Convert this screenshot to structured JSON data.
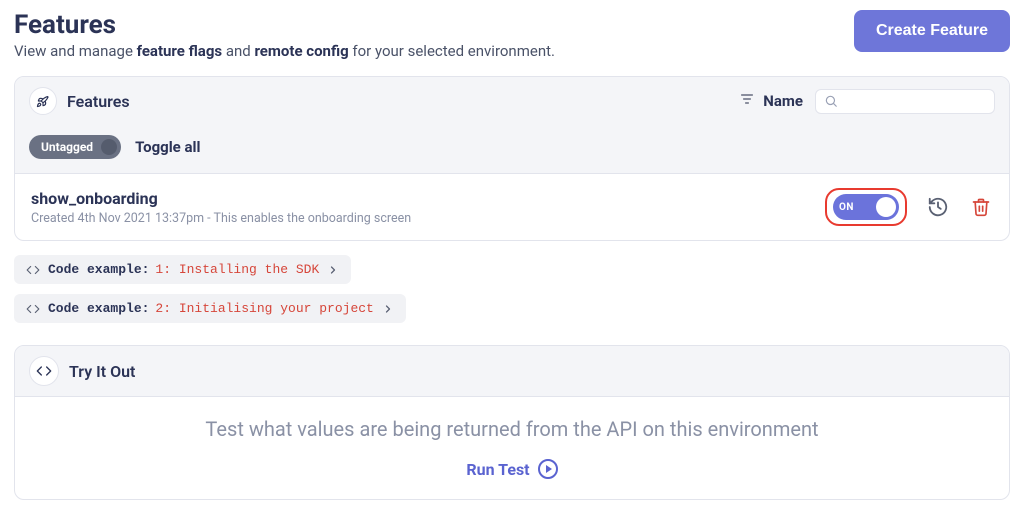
{
  "header": {
    "title": "Features",
    "subtitle_pre": "View and manage ",
    "subtitle_b1": "feature flags",
    "subtitle_mid": " and ",
    "subtitle_b2": "remote config",
    "subtitle_post": " for your selected environment.",
    "create_button": "Create Feature"
  },
  "features_panel": {
    "title": "Features",
    "sort_label": "Name",
    "search_placeholder": "",
    "tag": "Untagged",
    "toggle_all_label": "Toggle all",
    "items": [
      {
        "name": "show_onboarding",
        "meta": "Created 4th Nov 2021 13:37pm - This enables the onboarding screen",
        "toggle_state": "ON"
      }
    ]
  },
  "code_examples": [
    {
      "prefix": "Code example:",
      "detail": "1: Installing the SDK"
    },
    {
      "prefix": "Code example:",
      "detail": "2: Initialising your project"
    }
  ],
  "try_panel": {
    "title": "Try It Out",
    "description": "Test what values are being returned from the API on this environment",
    "run_label": "Run Test"
  }
}
